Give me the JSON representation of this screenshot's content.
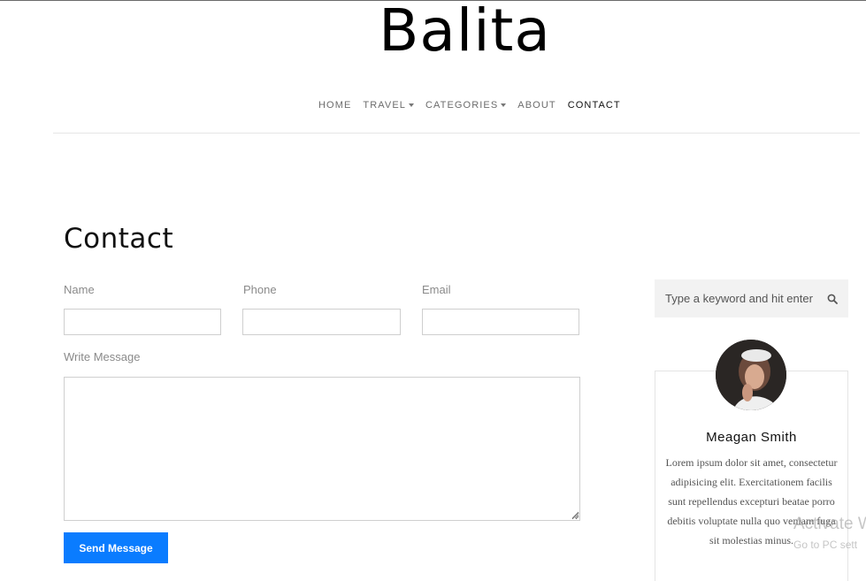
{
  "site": {
    "logo": "Balita"
  },
  "nav": {
    "items": [
      {
        "label": "HOME",
        "dropdown": false
      },
      {
        "label": "TRAVEL",
        "dropdown": true
      },
      {
        "label": "CATEGORIES",
        "dropdown": true
      },
      {
        "label": "ABOUT",
        "dropdown": false
      },
      {
        "label": "CONTACT",
        "dropdown": false,
        "active": true
      }
    ]
  },
  "contact": {
    "title": "Contact",
    "name_label": "Name",
    "phone_label": "Phone",
    "email_label": "Email",
    "message_label": "Write Message",
    "name_value": "",
    "phone_value": "",
    "email_value": "",
    "message_value": "",
    "submit_label": "Send Message"
  },
  "sidebar": {
    "search_placeholder": "Type a keyword and hit enter",
    "bio_name": "Meagan Smith",
    "bio_text": "Lorem ipsum dolor sit amet, consectetur adipisicing elit. Exercitationem facilis sunt repellendus excepturi beatae porro debitis voluptate nulla quo veniam fuga sit molestias minus."
  },
  "watermark": {
    "line1": "Activate W",
    "line2": "Go to PC sett"
  },
  "colors": {
    "accent": "#0a7cff",
    "search_bg": "#f2f2f2",
    "border": "#cfcfcf"
  }
}
